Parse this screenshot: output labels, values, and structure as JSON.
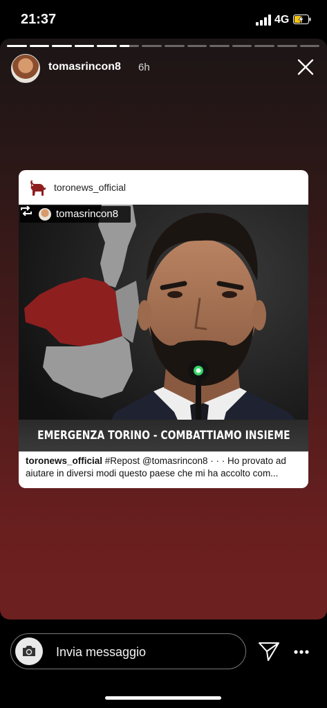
{
  "status_bar": {
    "time": "21:37",
    "network": "4G",
    "icons": [
      "signal-icon",
      "battery-charging-icon"
    ]
  },
  "story": {
    "username": "tomasrincon8",
    "time_ago": "6h",
    "segments_total": 14,
    "segments_completed": 5,
    "current_segment_progress": 0.5,
    "background_colors": [
      "#1c1616",
      "#6d2020"
    ]
  },
  "post": {
    "account": "toronews_official",
    "repost_user": "tomasrincon8",
    "banner_text": "EMERGENZA TORINO - COMBATTIAMO INSIEME",
    "caption_user": "toronews_official",
    "caption_line1": " #Repost @tomasrincon8 · · ·  Ho provato ad",
    "caption_line2": "aiutare in diversi modi questo paese che mi ha accolto com...",
    "map_region_color": "#8e1f1f",
    "map_other_color": "#9a9a9a"
  },
  "reply_bar": {
    "placeholder": "Invia messaggio",
    "icons": [
      "camera-icon",
      "send-icon",
      "more-icon"
    ]
  }
}
